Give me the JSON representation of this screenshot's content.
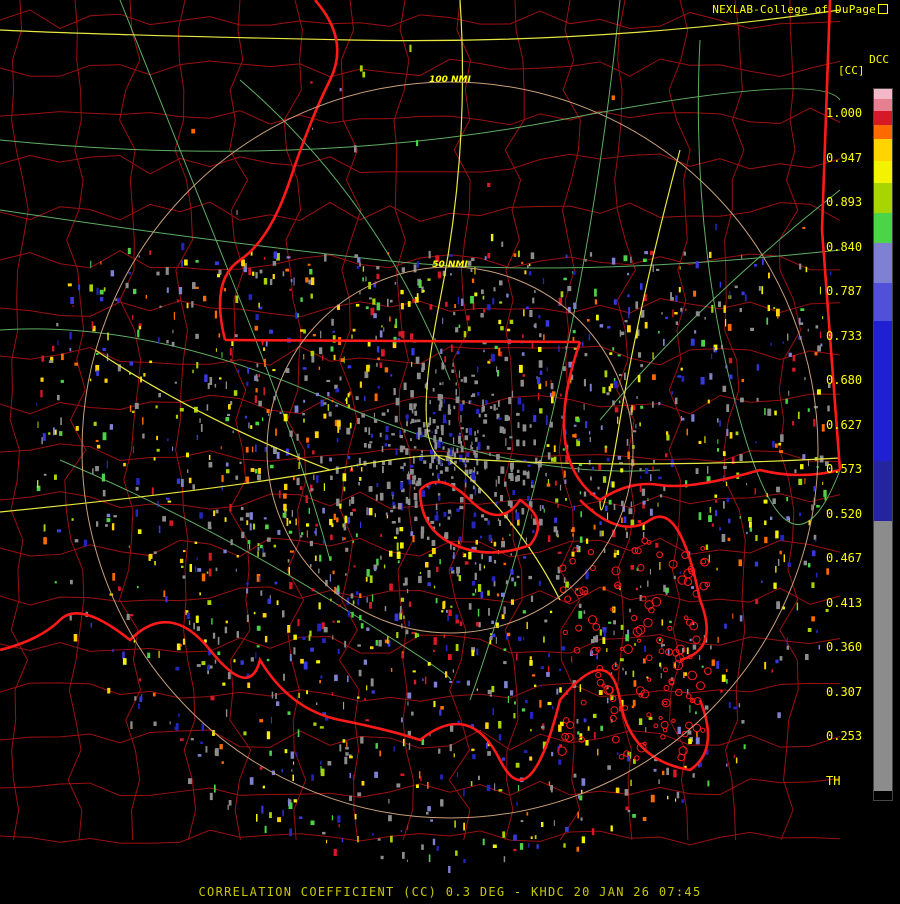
{
  "credit": {
    "text": "NEXLAB-College of DuPage",
    "icon": "external-link-icon"
  },
  "legend": {
    "product": "DCC",
    "unit": "[CC]",
    "ticks": [
      "1.000",
      "0.947",
      "0.893",
      "0.840",
      "0.787",
      "0.733",
      "0.680",
      "0.627",
      "0.573",
      "0.520",
      "0.467",
      "0.413",
      "0.360",
      "0.307",
      "0.253",
      "TH"
    ],
    "colors": [
      "#f3b7c7",
      "#e4808f",
      "#d61827",
      "#ff6a00",
      "#ffd400",
      "#f3f300",
      "#a8d400",
      "#4bd448",
      "#7e80d1",
      "#5050d8",
      "#1f1fd4",
      "#2424a0",
      "#8c8c8c",
      "#000000"
    ]
  },
  "range_rings": {
    "inner": "50 NMI",
    "outer": "100 NMI"
  },
  "footer": {
    "text": "CORRELATION COEFFICIENT (CC) 0.3 DEG - KHDC 20 JAN 26 07:45"
  }
}
